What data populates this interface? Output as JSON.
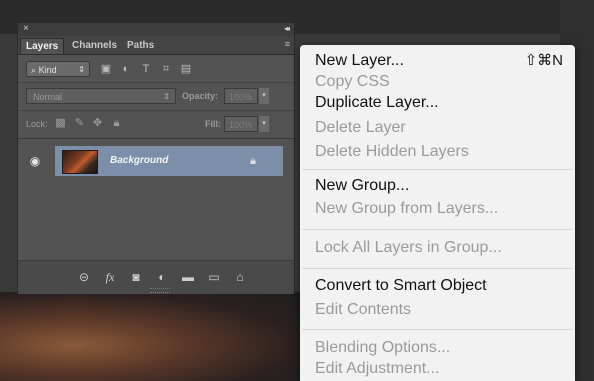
{
  "panel": {
    "close_glyph": "×",
    "collapse_glyph": "◂◂",
    "menu_glyph": "≡",
    "tabs": [
      {
        "label": "Layers",
        "active": true
      },
      {
        "label": "Channels",
        "active": false
      },
      {
        "label": "Paths",
        "active": false
      }
    ],
    "filter": {
      "kind_label": "Kind",
      "kind_arrow": "⇕"
    },
    "blend": {
      "mode": "Normal",
      "arrow": "⇕",
      "opacity_label": "Opacity:",
      "opacity_value": "100%"
    },
    "lock": {
      "label": "Lock:",
      "fill_label": "Fill:",
      "fill_value": "100%"
    },
    "layers": [
      {
        "name": "Background",
        "visible": true,
        "locked": true,
        "selected": true
      }
    ]
  },
  "menu": {
    "sections": [
      [
        {
          "label": "New Layer...",
          "shortcut": "⇧⌘N",
          "enabled": true
        },
        {
          "label": "Copy CSS",
          "enabled": false
        },
        {
          "label": "Duplicate Layer...",
          "enabled": true
        },
        {
          "label": "Delete Layer",
          "enabled": false
        },
        {
          "label": "Delete Hidden Layers",
          "enabled": false
        }
      ],
      [
        {
          "label": "New Group...",
          "enabled": true
        },
        {
          "label": "New Group from Layers...",
          "enabled": false
        }
      ],
      [
        {
          "label": "Lock All Layers in Group...",
          "enabled": false
        }
      ],
      [
        {
          "label": "Convert to Smart Object",
          "enabled": true
        },
        {
          "label": "Edit Contents",
          "enabled": false
        }
      ],
      [
        {
          "label": "Blending Options...",
          "enabled": false
        },
        {
          "label": "Edit Adjustment...",
          "enabled": false
        }
      ]
    ]
  },
  "colors": {
    "panel_bg": "#535353",
    "selection": "#7d8fa8",
    "menu_bg": "#f2f2f2",
    "menu_disabled": "#9a9a9a"
  }
}
